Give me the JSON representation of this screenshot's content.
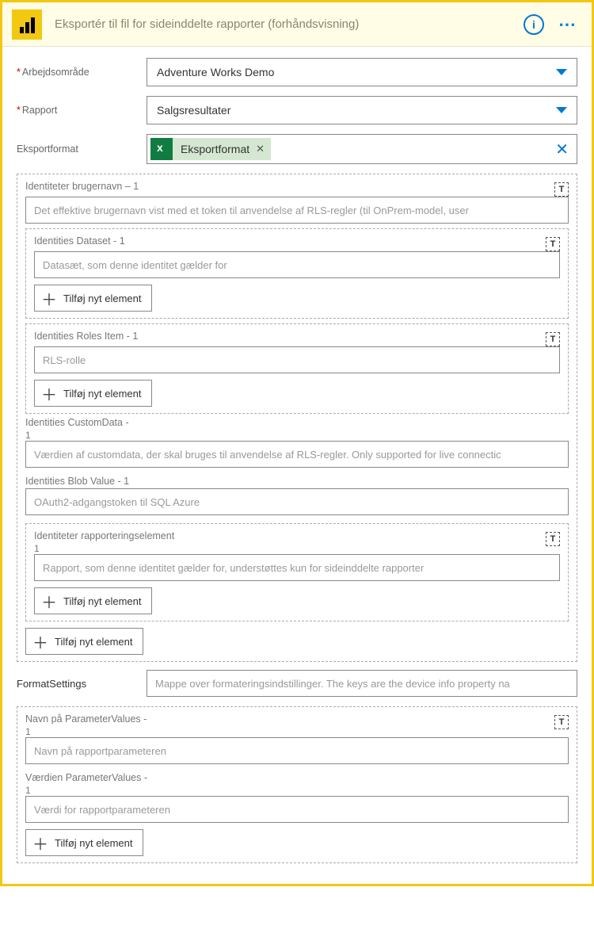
{
  "header": {
    "title": "Eksportér til fil for sideinddelte rapporter (forhåndsvisning)",
    "info_glyph": "i",
    "more_glyph": "⋯"
  },
  "fields": {
    "workspace": {
      "label": "Arbejdsområde",
      "value": "Adventure Works Demo",
      "required": true
    },
    "report": {
      "label": "Rapport",
      "value": "Salgsresultater",
      "required": true
    },
    "exportformat": {
      "label": "Eksportformat",
      "token": "Eksportformat"
    }
  },
  "sections": {
    "idUsername": {
      "label": "Identiteter brugernavn –  1",
      "placeholder": "Det effektive brugernavn vist med et token til anvendelse af RLS-regler (til OnPrem-model, user"
    },
    "idDataset": {
      "label": "Identities Dataset - 1",
      "placeholder": "Datasæt, som denne identitet gælder for",
      "addLabel": "Tilføj nyt element"
    },
    "idRoles": {
      "label": "Identities Roles Item - 1",
      "placeholder": "RLS-rolle",
      "addLabel": "Tilføj nyt element"
    },
    "idCustomData": {
      "label": "Identities CustomData -",
      "sub": "1",
      "placeholder": "Værdien af customdata, der skal bruges til anvendelse af RLS-regler. Only supported for live connectic"
    },
    "idBlob": {
      "label": "Identities Blob Value - 1",
      "placeholder": "OAuth2-adgangstoken til SQL Azure"
    },
    "idReportItem": {
      "label": "Identiteter rapporteringselement",
      "sub": "1",
      "placeholder": "Rapport, som denne identitet gælder for, understøttes kun for sideinddelte rapporter",
      "addLabel": "Tilføj nyt element"
    },
    "outerAdd": "Tilføj nyt element",
    "formatSettings": {
      "label": "FormatSettings",
      "placeholder": "Mappe over formateringsindstillinger. The keys are the device info property na"
    },
    "paramName": {
      "label": "Navn på ParameterValues  -",
      "sub": "1",
      "placeholder": "Navn på rapportparameteren"
    },
    "paramValue": {
      "label": "Værdien ParameterValues  -",
      "sub": "1",
      "placeholder": "Værdi for rapportparameteren"
    },
    "paramAdd": "Tilføj nyt element"
  },
  "icons": {
    "t_glyph": "T"
  }
}
